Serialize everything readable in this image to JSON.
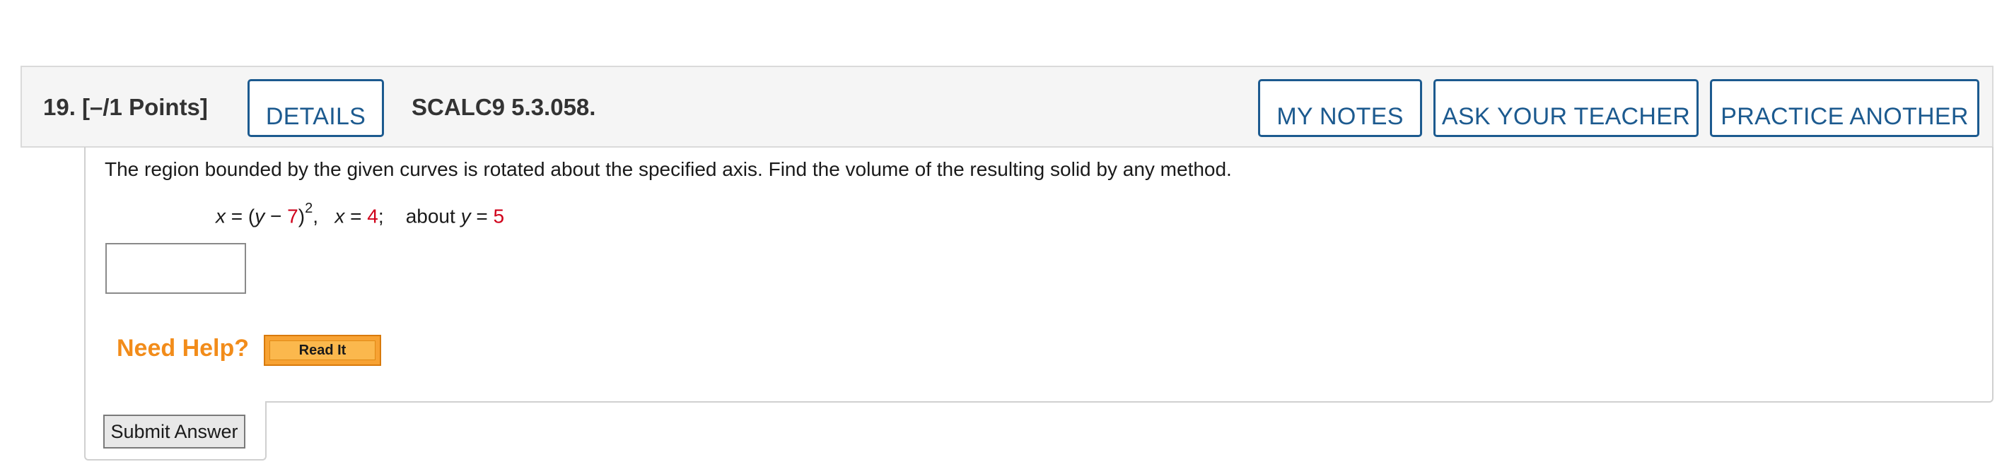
{
  "question": {
    "number_points": "19.  [–/1 Points]",
    "details_label": "DETAILS",
    "reference": "SCALC9 5.3.058.",
    "my_notes_label": "MY NOTES",
    "ask_teacher_label": "ASK YOUR TEACHER",
    "practice_another_label": "PRACTICE ANOTHER"
  },
  "problem": {
    "prompt": "The region bounded by the given curves is rotated about the specified axis. Find the volume of the resulting solid by any method.",
    "math": {
      "x1": "x",
      "eq1": " = (",
      "y1": "y",
      "minus": " − ",
      "k1": "7",
      "close1": ")",
      "exp": "2",
      "sep1": ",   ",
      "x2": "x",
      "eq2": " = ",
      "k2": "4",
      "sep2": ";    about ",
      "y2": "y",
      "eq3": " = ",
      "k3": "5"
    },
    "answer_value": ""
  },
  "help": {
    "label": "Need Help?",
    "read_it_label": "Read It"
  },
  "submit_label": "Submit Answer"
}
